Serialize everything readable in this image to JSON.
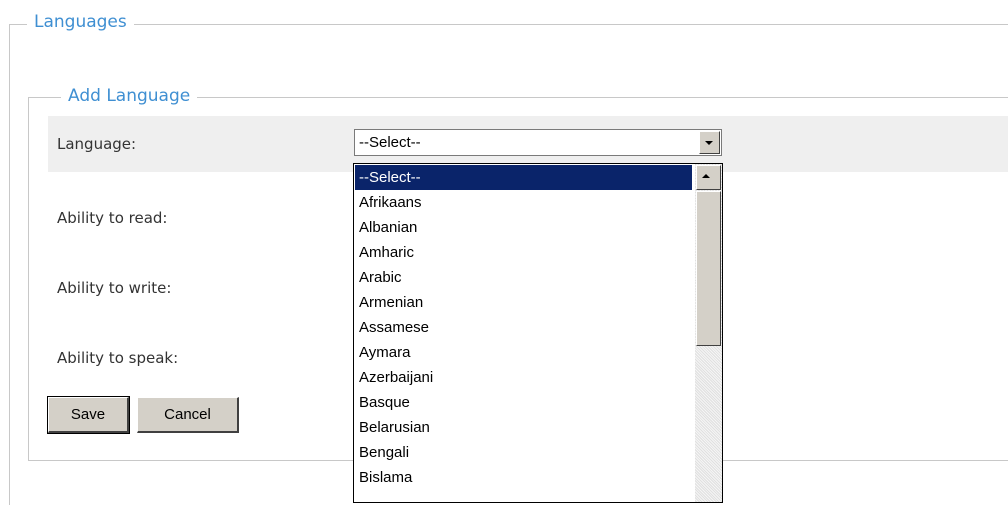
{
  "section_title": "Languages",
  "form": {
    "legend": "Add Language",
    "fields": {
      "language_label": "Language:",
      "read_label": "Ability to read:",
      "write_label": "Ability to write:",
      "speak_label": "Ability to speak:"
    },
    "language_select": {
      "value": "--Select--",
      "options": [
        "--Select--",
        "Afrikaans",
        "Albanian",
        "Amharic",
        "Arabic",
        "Armenian",
        "Assamese",
        "Aymara",
        "Azerbaijani",
        "Basque",
        "Belarusian",
        "Bengali",
        "Bislama"
      ],
      "highlighted_option": "--Select--"
    },
    "buttons": {
      "save": "Save",
      "cancel": "Cancel"
    }
  },
  "colors": {
    "legend_text": "#3f8fd2",
    "highlight": "#0a246a",
    "row_shade": "#efefef"
  }
}
